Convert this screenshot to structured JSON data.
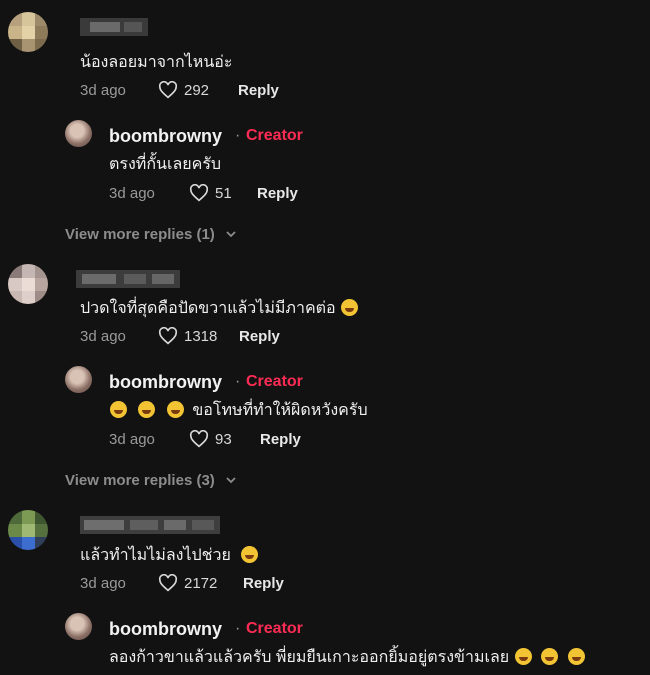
{
  "comments": [
    {
      "text": "น้องลอยมาจากไหนอ่ะ",
      "time": "3d ago",
      "likes": "292",
      "reply_label": "Reply",
      "reply": {
        "author": "boombrowny",
        "separator": "·",
        "badge": "Creator",
        "text": "ตรงที่กั้นเลยครับ",
        "time": "3d ago",
        "likes": "51",
        "reply_label": "Reply"
      },
      "view_more": "View more replies (1)"
    },
    {
      "text": "ปวดใจที่สุดคือปัดขวาแล้วไม่มีภาคต่อ",
      "time": "3d ago",
      "likes": "1318",
      "reply_label": "Reply",
      "reply": {
        "author": "boombrowny",
        "separator": "·",
        "badge": "Creator",
        "text": "ขอโทษที่ทำให้ผิดหวังครับ",
        "time": "3d ago",
        "likes": "93",
        "reply_label": "Reply"
      },
      "view_more": "View more replies (3)"
    },
    {
      "text": "แล้วทำไมไม่ลงไปช่วย",
      "time": "3d ago",
      "likes": "2172",
      "reply_label": "Reply",
      "reply": {
        "author": "boombrowny",
        "separator": "·",
        "badge": "Creator",
        "text": "ลองก้าวขาแล้วแล้วครับ พี่ยมยืนเกาะออกยิ้มอยู่ตรงข้ามเลย"
      }
    }
  ],
  "icons": {
    "like": "heart-outline-icon",
    "expand": "chevron-down-icon",
    "emoji": "grinning-squinting-face-emoji"
  },
  "colors": {
    "background": "#121212",
    "creator_badge": "#fe2c55",
    "muted": "#9a9a9a"
  }
}
